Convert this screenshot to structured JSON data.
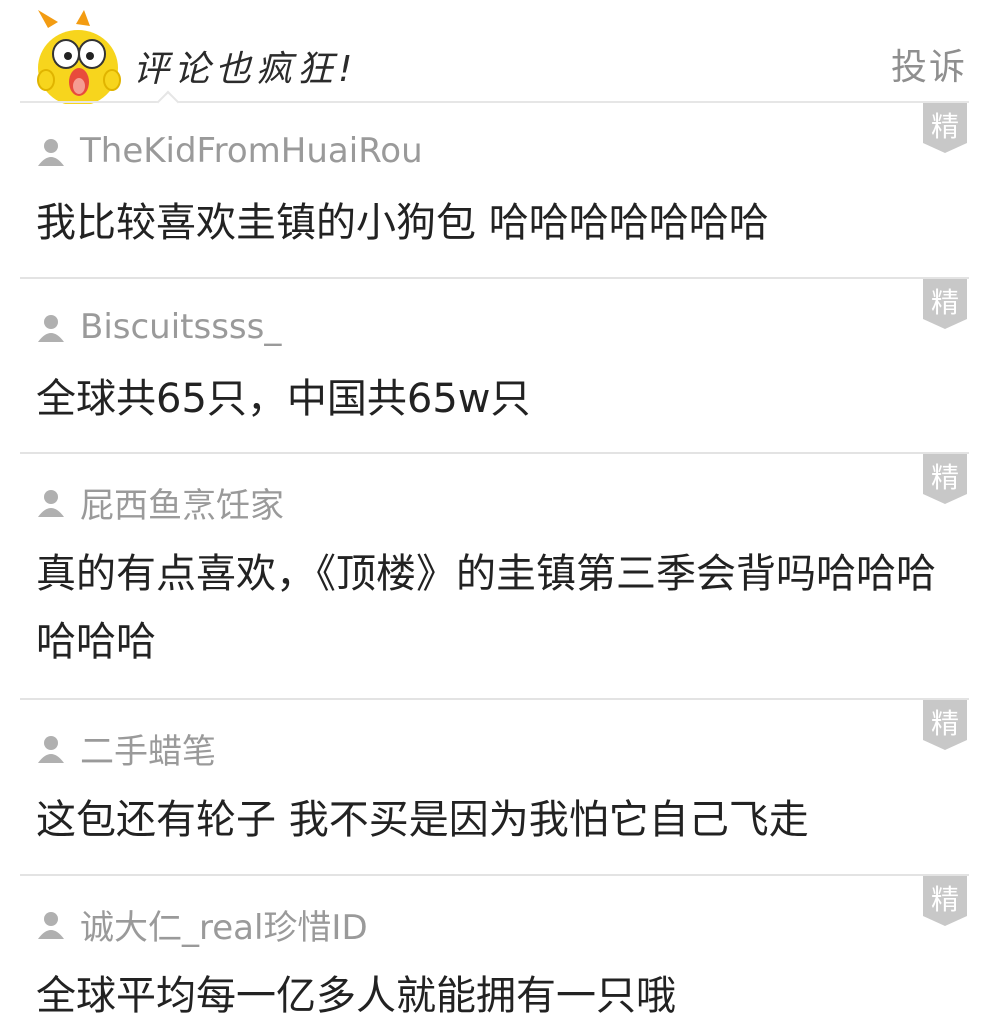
{
  "header": {
    "title": "评论也疯狂!",
    "report_label": "投诉"
  },
  "badge_label": "精",
  "comments": [
    {
      "user": "TheKidFromHuaiRou",
      "text": "我比较喜欢圭镇的小狗包 哈哈哈哈哈哈哈"
    },
    {
      "user": "Biscuitssss_",
      "text": "全球共65只，中国共65w只"
    },
    {
      "user": "屁西鱼烹饪家",
      "text": "真的有点喜欢，《顶楼》的圭镇第三季会背吗哈哈哈哈哈哈"
    },
    {
      "user": "二手蜡笔",
      "text": "这包还有轮子 我不买是因为我怕它自己飞走"
    },
    {
      "user": "诚大仁_real珍惜ID",
      "text": "全球平均每一亿多人就能拥有一只哦"
    }
  ]
}
